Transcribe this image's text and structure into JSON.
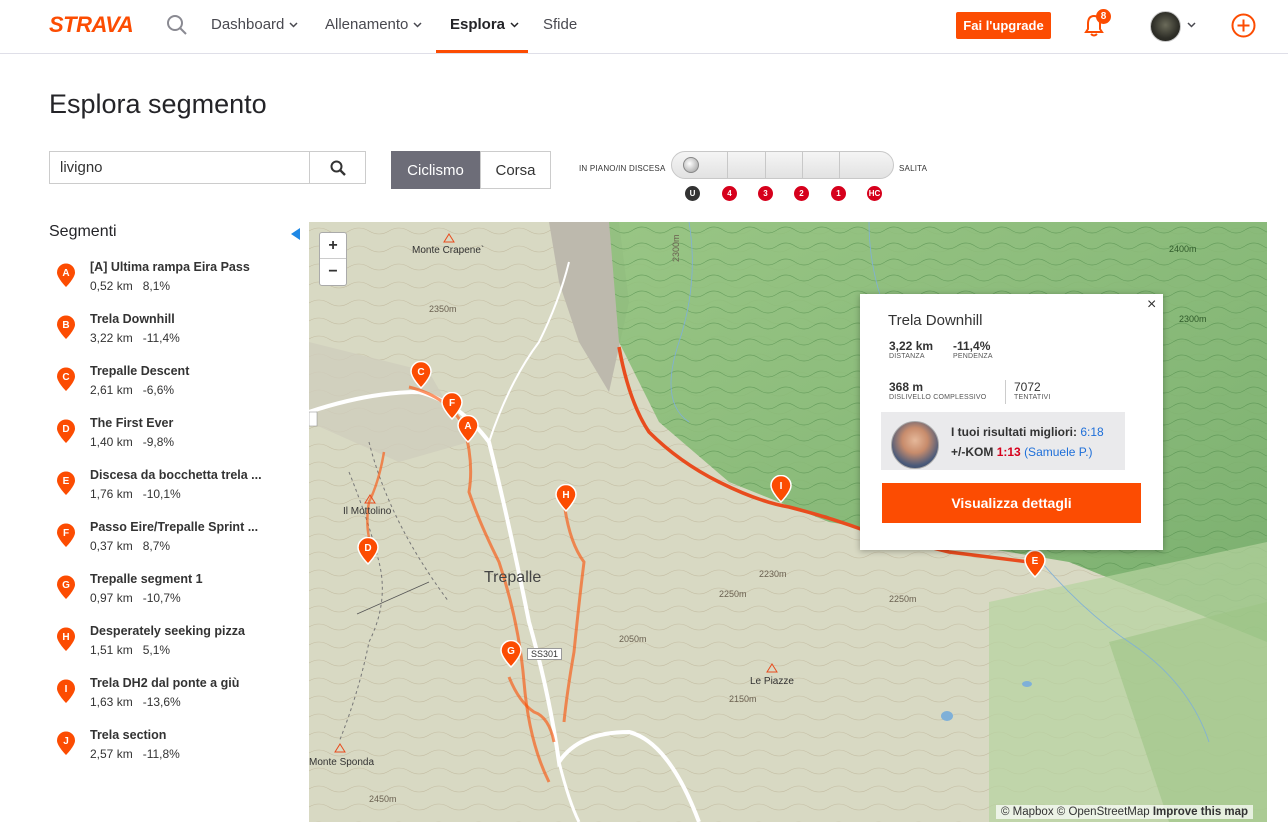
{
  "brand": "STRAVA",
  "nav": {
    "dashboard": "Dashboard",
    "training": "Allenamento",
    "explore": "Esplora",
    "challenges": "Sfide",
    "upgrade": "Fai l'upgrade",
    "notifications": "8"
  },
  "page": {
    "title": "Esplora segmento",
    "search_value": "livigno"
  },
  "sport": {
    "cycling": "Ciclismo",
    "running": "Corsa",
    "selected": "Ciclismo"
  },
  "climb": {
    "flat_label": "IN PIANO/IN DISCESA",
    "climb_label": "SALITA",
    "categories": [
      "U",
      "4",
      "3",
      "2",
      "1",
      "HC"
    ]
  },
  "segments": {
    "heading": "Segmenti",
    "items": [
      {
        "letter": "A",
        "name": "[A] Ultima rampa Eira Pass",
        "distance": "0,52 km",
        "grade": "8,1%"
      },
      {
        "letter": "B",
        "name": "Trela Downhill",
        "distance": "3,22 km",
        "grade": "-11,4%"
      },
      {
        "letter": "C",
        "name": "Trepalle Descent",
        "distance": "2,61 km",
        "grade": "-6,6%"
      },
      {
        "letter": "D",
        "name": "The First Ever",
        "distance": "1,40 km",
        "grade": "-9,8%"
      },
      {
        "letter": "E",
        "name": "Discesa da bocchetta trela ...",
        "distance": "1,76 km",
        "grade": "-10,1%"
      },
      {
        "letter": "F",
        "name": "Passo Eire/Trepalle Sprint ...",
        "distance": "0,37 km",
        "grade": "8,7%"
      },
      {
        "letter": "G",
        "name": "Trepalle segment 1",
        "distance": "0,97 km",
        "grade": "-10,7%"
      },
      {
        "letter": "H",
        "name": "Desperately seeking pizza",
        "distance": "1,51 km",
        "grade": "5,1%"
      },
      {
        "letter": "I",
        "name": "Trela DH2 dal ponte a giù",
        "distance": "1,63 km",
        "grade": "-13,6%"
      },
      {
        "letter": "J",
        "name": "Trela section",
        "distance": "2,57 km",
        "grade": "-11,8%"
      }
    ]
  },
  "map": {
    "zoom_in": "+",
    "zoom_out": "−",
    "labels": {
      "monte_crapene": "Monte Crapene`",
      "il_mottolino": "Il Mottolino",
      "trepalle": "Trepalle",
      "le_piazze": "Le Piazze",
      "monte_sponda": "Monte Sponda",
      "road": "SS301"
    },
    "attribution_prefix": "© Mapbox © OpenStreetMap",
    "attribution_link": "Improve this map",
    "marker_letters": [
      "C",
      "F",
      "A",
      "H",
      "D",
      "G",
      "I",
      "E"
    ]
  },
  "popup": {
    "title": "Trela Downhill",
    "distance": "3,22 km",
    "distance_label": "DISTANZA",
    "grade": "-11,4%",
    "grade_label": "PENDENZA",
    "elevation": "368 m",
    "elevation_label": "DISLIVELLO COMPLESSIVO",
    "attempts": "7072",
    "attempts_label": "TENTATIVI",
    "best_label": "I tuoi risultati migliori:",
    "best_time": "6:18",
    "kom_label": "+/-KOM",
    "kom_time": "1:13",
    "kom_holder": "(Samuele P.)",
    "details_button": "Visualizza dettagli",
    "close": "×"
  },
  "colors": {
    "brand": "#fc4c02",
    "climb_category": "#d6001c",
    "link": "#1e6fd9"
  }
}
